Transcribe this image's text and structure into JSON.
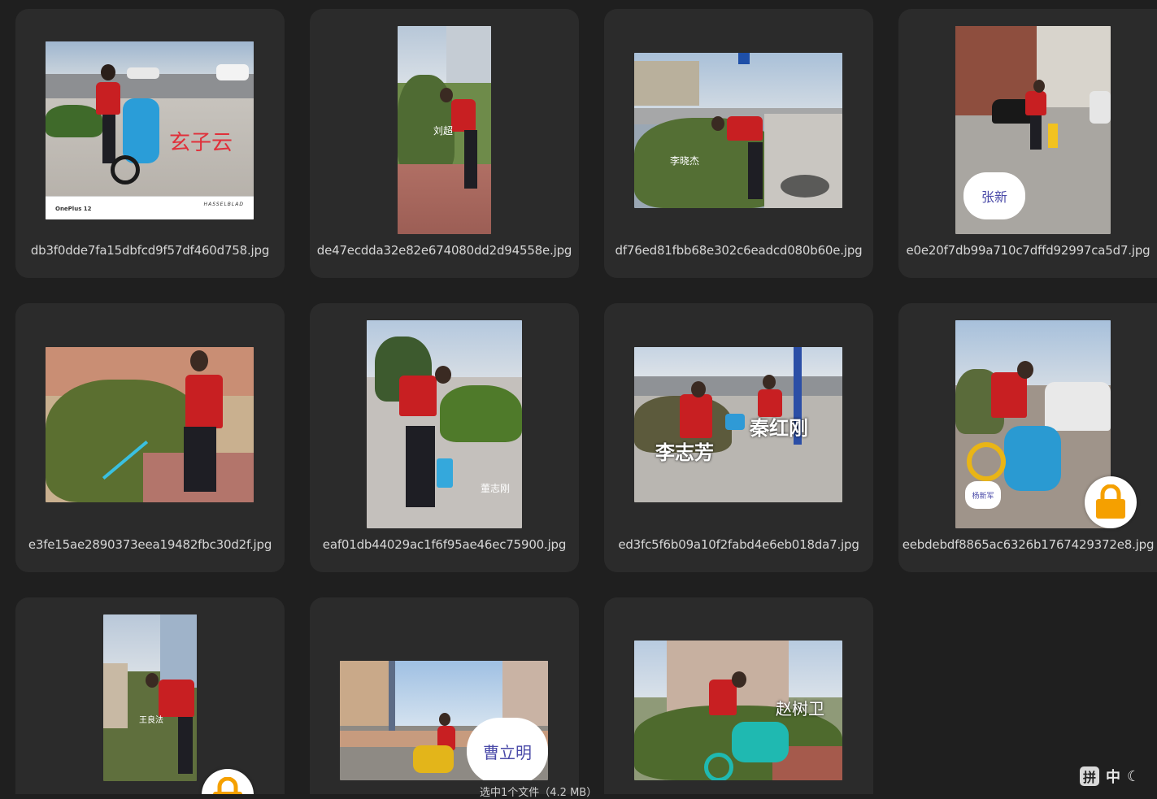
{
  "files": [
    {
      "name": "db3f0dde7fa15dbfcd9f57df460d758.jpg",
      "overlay": "玄子云",
      "footer_left": "OnePlus 12",
      "footer_right": "HASSELBLAD"
    },
    {
      "name": "de47ecdda32e82e674080dd2d94558e.jpg",
      "overlay": "刘超"
    },
    {
      "name": "df76ed81fbb68e302c6eadcd080b60e.jpg",
      "overlay": "李晓杰"
    },
    {
      "name": "e0e20f7db99a710c7dffd92997ca5d7.jpg",
      "overlay": "张新"
    },
    {
      "name": "e3fe15ae2890373eea19482fbc30d2f.jpg"
    },
    {
      "name": "eaf01db44029ac1f6f95ae46ec75900.jpg",
      "overlay": "董志刚"
    },
    {
      "name": "ed3fc5f6b09a10f2fabd4e6eb018da7.jpg",
      "overlay": "秦红刚",
      "overlay2": "李志芳"
    },
    {
      "name": "eebdebdf8865ac6326b1767429372e8.jpg",
      "overlay": "杨新军",
      "locked": true
    },
    {
      "name": "",
      "overlay": "王良法"
    },
    {
      "name": "",
      "overlay": "曹立明"
    },
    {
      "name": "",
      "overlay": "赵树卫"
    }
  ],
  "status_bar": {
    "text": "选中1个文件（4.2 MB）"
  },
  "ime": {
    "mode_key": "拼",
    "lang": "中",
    "theme_icon": "moon-icon"
  },
  "colors": {
    "background": "#1f1f1f",
    "card": "#2b2b2b",
    "vest": "#c81f22",
    "lock": "#f5a000"
  }
}
